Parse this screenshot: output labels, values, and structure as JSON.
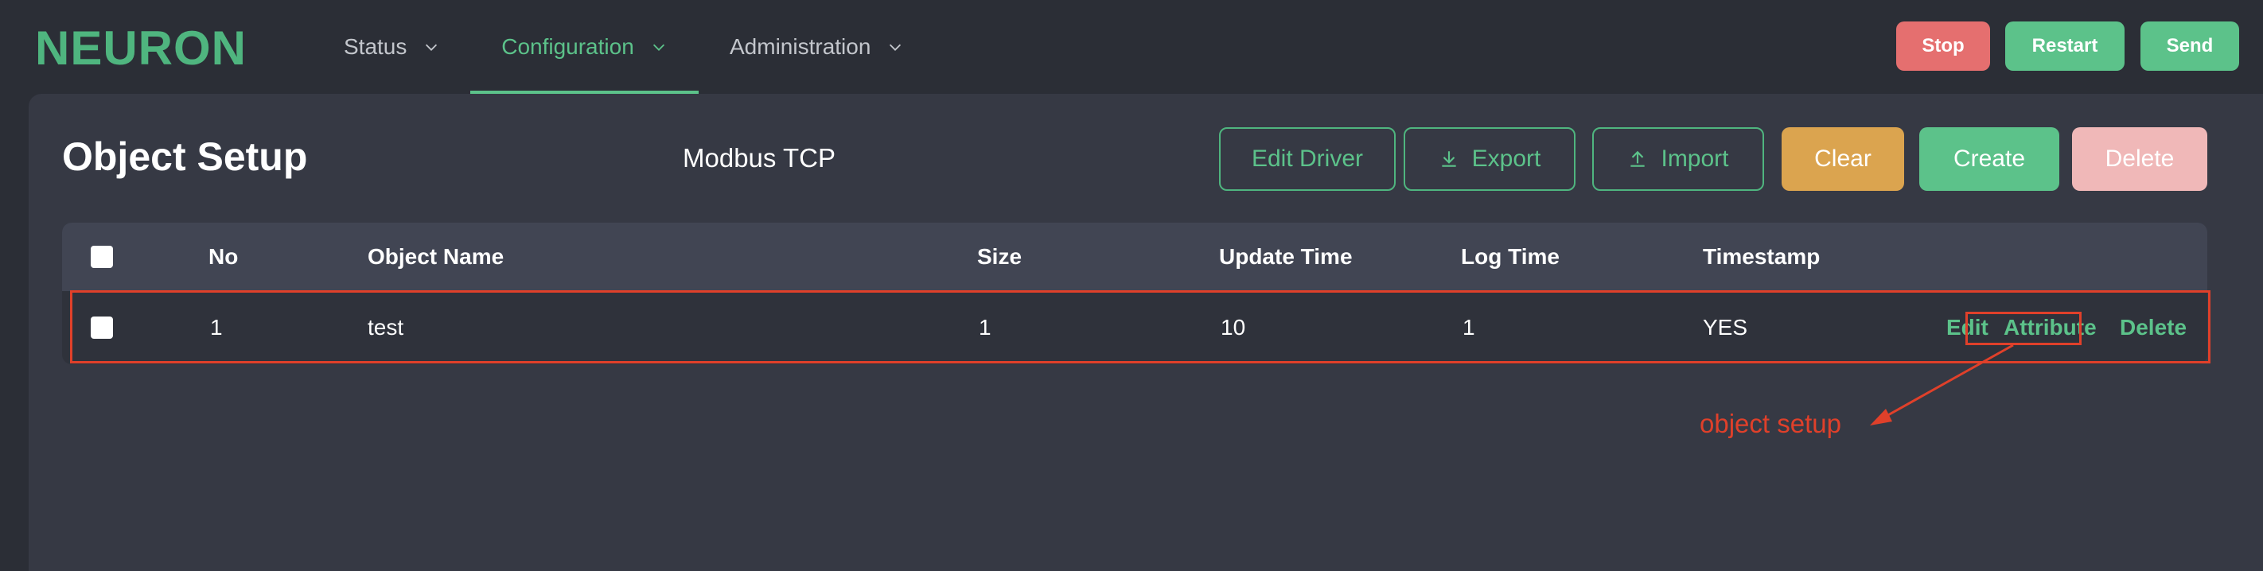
{
  "app": {
    "logo": "NEURON"
  },
  "nav": {
    "items": [
      {
        "label": "Status",
        "active": false
      },
      {
        "label": "Configuration",
        "active": true
      },
      {
        "label": "Administration",
        "active": false
      }
    ]
  },
  "header_buttons": {
    "stop": "Stop",
    "restart": "Restart",
    "send": "Send"
  },
  "page": {
    "title": "Object Setup",
    "driver": "Modbus TCP"
  },
  "toolbar": {
    "edit_driver": "Edit Driver",
    "export": "Export",
    "import": "Import",
    "clear": "Clear",
    "create": "Create",
    "delete": "Delete"
  },
  "table": {
    "columns": [
      "No",
      "Object Name",
      "Size",
      "Update Time",
      "Log Time",
      "Timestamp"
    ],
    "rows": [
      {
        "no": "1",
        "object_name": "test",
        "size": "1",
        "update_time": "10",
        "log_time": "1",
        "timestamp": "YES",
        "actions": [
          "Edit",
          "Attribute",
          "Delete"
        ]
      }
    ]
  },
  "annotation": {
    "text": "object setup"
  },
  "colors": {
    "accent": "#5cc28a",
    "stop": "#e56f6f",
    "clear": "#dba44f",
    "delete_disabled": "#f0b8b8",
    "annotation": "#e0402a",
    "background": "#2b2e36",
    "panel": "#363944"
  },
  "icons": {
    "nav_chevron": "chevron-down-icon",
    "export": "download-icon",
    "import": "upload-icon"
  }
}
